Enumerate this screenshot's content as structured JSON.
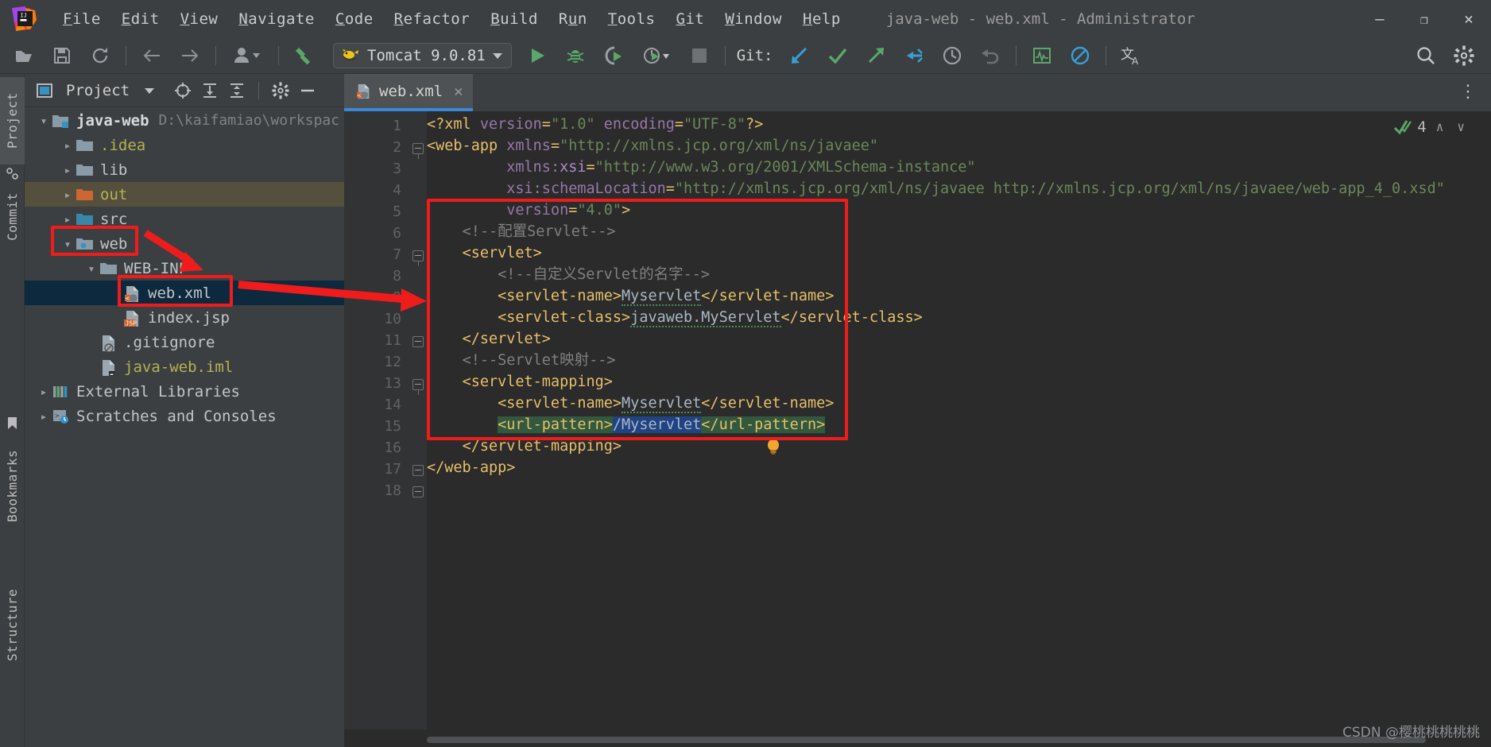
{
  "window": {
    "title": "java-web - web.xml - Administrator",
    "controls": {
      "minimize": "—",
      "maximize": "❐",
      "close": "✕"
    }
  },
  "menu": {
    "items": [
      {
        "mnemonic": "F",
        "rest": "ile",
        "name": "file"
      },
      {
        "mnemonic": "E",
        "rest": "dit",
        "name": "edit"
      },
      {
        "mnemonic": "V",
        "rest": "iew",
        "name": "view"
      },
      {
        "mnemonic": "N",
        "rest": "avigate",
        "name": "navigate"
      },
      {
        "mnemonic": "C",
        "rest": "ode",
        "name": "code"
      },
      {
        "mnemonic": "R",
        "rest": "efactor",
        "name": "refactor"
      },
      {
        "mnemonic": "B",
        "rest": "uild",
        "name": "build"
      },
      {
        "mnemonic": "R",
        "rest": "un",
        "name": "run",
        "mnemonic_pos": "middle",
        "pre": "R",
        "mid": "u",
        "post": "n"
      },
      {
        "mnemonic": "T",
        "rest": "ools",
        "name": "tools"
      },
      {
        "mnemonic": "G",
        "rest": "it",
        "name": "git"
      },
      {
        "mnemonic": "W",
        "rest": "indow",
        "name": "window"
      },
      {
        "mnemonic": "H",
        "rest": "elp",
        "name": "help"
      }
    ]
  },
  "toolbar": {
    "run_config": "Tomcat 9.0.81",
    "git_label": "Git:",
    "icons": [
      "open-folder-icon",
      "save-icon",
      "sync-icon",
      "back-arrow-icon",
      "forward-arrow-icon",
      "profile-icon",
      "build-hammer-icon",
      "run-icon",
      "debug-icon",
      "run-coverage-icon",
      "profiler-icon",
      "stop-icon",
      "git-update-icon",
      "git-commit-icon",
      "git-push-icon",
      "git-pull-request-icon",
      "git-history-icon",
      "git-rollback-icon",
      "monitor-icon",
      "no-entry-icon",
      "translate-icon",
      "search-icon",
      "settings-gear-icon"
    ]
  },
  "left_strip": {
    "tabs": [
      {
        "label": "Project",
        "name": "tool-window-project",
        "active": true
      },
      {
        "label": "Commit",
        "name": "tool-window-commit",
        "active": false
      },
      {
        "label": "Bookmarks",
        "name": "tool-window-bookmarks",
        "active": false
      },
      {
        "label": "Structure",
        "name": "tool-window-structure",
        "active": false
      }
    ]
  },
  "project_panel": {
    "title": "Project",
    "header_icons": [
      "select-opened-file-icon",
      "expand-all-icon",
      "collapse-all-icon",
      "settings-gear-icon",
      "hide-icon"
    ],
    "tree": [
      {
        "label": "java-web",
        "path": "D:\\kaifamiao\\workspac",
        "depth": 0,
        "expanded": true,
        "icon": "module-folder-icon",
        "state": "normal",
        "bold": true
      },
      {
        "label": ".idea",
        "path": "",
        "depth": 1,
        "expanded": false,
        "icon": "folder-icon",
        "state": "normal",
        "color": "#b5b154"
      },
      {
        "label": "lib",
        "path": "",
        "depth": 1,
        "expanded": false,
        "icon": "folder-icon",
        "state": "normal"
      },
      {
        "label": "out",
        "path": "",
        "depth": 1,
        "expanded": false,
        "icon": "folder-orange-icon",
        "state": "out-highlight",
        "color": "#b5b154"
      },
      {
        "label": "src",
        "path": "",
        "depth": 1,
        "expanded": false,
        "icon": "folder-blue-icon",
        "state": "normal"
      },
      {
        "label": "web",
        "path": "",
        "depth": 1,
        "expanded": true,
        "icon": "folder-web-icon",
        "state": "normal"
      },
      {
        "label": "WEB-INF",
        "path": "",
        "depth": 2,
        "expanded": true,
        "icon": "folder-icon",
        "state": "normal"
      },
      {
        "label": "web.xml",
        "path": "",
        "depth": 3,
        "expanded": null,
        "icon": "xml-file-icon",
        "state": "selected"
      },
      {
        "label": "index.jsp",
        "path": "",
        "depth": 3,
        "expanded": null,
        "icon": "jsp-file-icon",
        "state": "normal"
      },
      {
        "label": ".gitignore",
        "path": "",
        "depth": 2,
        "expanded": null,
        "icon": "gitignore-file-icon",
        "state": "normal"
      },
      {
        "label": "java-web.iml",
        "path": "",
        "depth": 2,
        "expanded": null,
        "icon": "iml-file-icon",
        "state": "normal",
        "color": "#b5b154"
      },
      {
        "label": "External Libraries",
        "path": "",
        "depth": 0,
        "expanded": false,
        "icon": "libraries-icon",
        "state": "normal"
      },
      {
        "label": "Scratches and Consoles",
        "path": "",
        "depth": 0,
        "expanded": false,
        "icon": "scratches-icon",
        "state": "normal"
      }
    ]
  },
  "editor": {
    "tab": {
      "label": "web.xml",
      "icon": "xml-file-icon",
      "close": "✕"
    },
    "inspection": {
      "count": "4",
      "icon": "inspection-ok-icon",
      "up": "∧",
      "down": "∨"
    },
    "more_icon": "⋮",
    "lines": [
      {
        "n": 1,
        "indent": 0
      },
      {
        "n": 2,
        "indent": 0,
        "fold": true
      },
      {
        "n": 3,
        "indent": 0
      },
      {
        "n": 4,
        "indent": 0
      },
      {
        "n": 5,
        "indent": 0
      },
      {
        "n": 6,
        "indent": 0
      },
      {
        "n": 7,
        "indent": 0,
        "fold": true
      },
      {
        "n": 8,
        "indent": 0
      },
      {
        "n": 9,
        "indent": 0
      },
      {
        "n": 10,
        "indent": 0
      },
      {
        "n": 11,
        "indent": 0,
        "fold": true
      },
      {
        "n": 12,
        "indent": 0
      },
      {
        "n": 13,
        "indent": 0,
        "fold": true
      },
      {
        "n": 14,
        "indent": 0
      },
      {
        "n": 15,
        "indent": 0,
        "bulb": true
      },
      {
        "n": 16,
        "indent": 0,
        "fold": true
      },
      {
        "n": 17,
        "indent": 0,
        "fold": true
      },
      {
        "n": 18,
        "indent": 0
      }
    ],
    "code": {
      "l1": "<?xml version=\"1.0\" encoding=\"UTF-8\"?>",
      "l2": "<web-app xmlns=\"http://xmlns.jcp.org/xml/ns/javaee\"",
      "l3": "xmlns:xsi=\"http://www.w3.org/2001/XMLSchema-instance\"",
      "l4": "xsi:schemaLocation=\"http://xmlns.jcp.org/xml/ns/javaee http://xmlns.jcp.org/xml/ns/javaee/web-app_4_0.xsd\"",
      "l5": "version=\"4.0\">",
      "l6": "<!--配置Servlet-->",
      "l7": "<servlet>",
      "l8": "<!--自定义Servlet的名字-->",
      "l9": "<servlet-name>Myservlet</servlet-name>",
      "l10": "<servlet-class>javaweb.MyServlet</servlet-class>",
      "l11": "</servlet>",
      "l12": "<!--Servlet映射-->",
      "l13": "<servlet-mapping>",
      "l14": "<servlet-name>Myservlet</servlet-name>",
      "l15": "<url-pattern>/Myservlet</url-pattern>",
      "l16": "</servlet-mapping>",
      "l17": "</web-app>"
    }
  },
  "annotations": {
    "boxes": [
      {
        "name": "highlight-box-web-folder"
      },
      {
        "name": "highlight-box-webxml-file"
      },
      {
        "name": "highlight-box-servlet-config"
      }
    ],
    "arrows": [
      {
        "name": "arrow-web-to-webxml"
      },
      {
        "name": "arrow-webxml-to-code"
      }
    ],
    "color": "#f01c1c"
  },
  "watermark": "CSDN @樱桃桃桃桃桃"
}
